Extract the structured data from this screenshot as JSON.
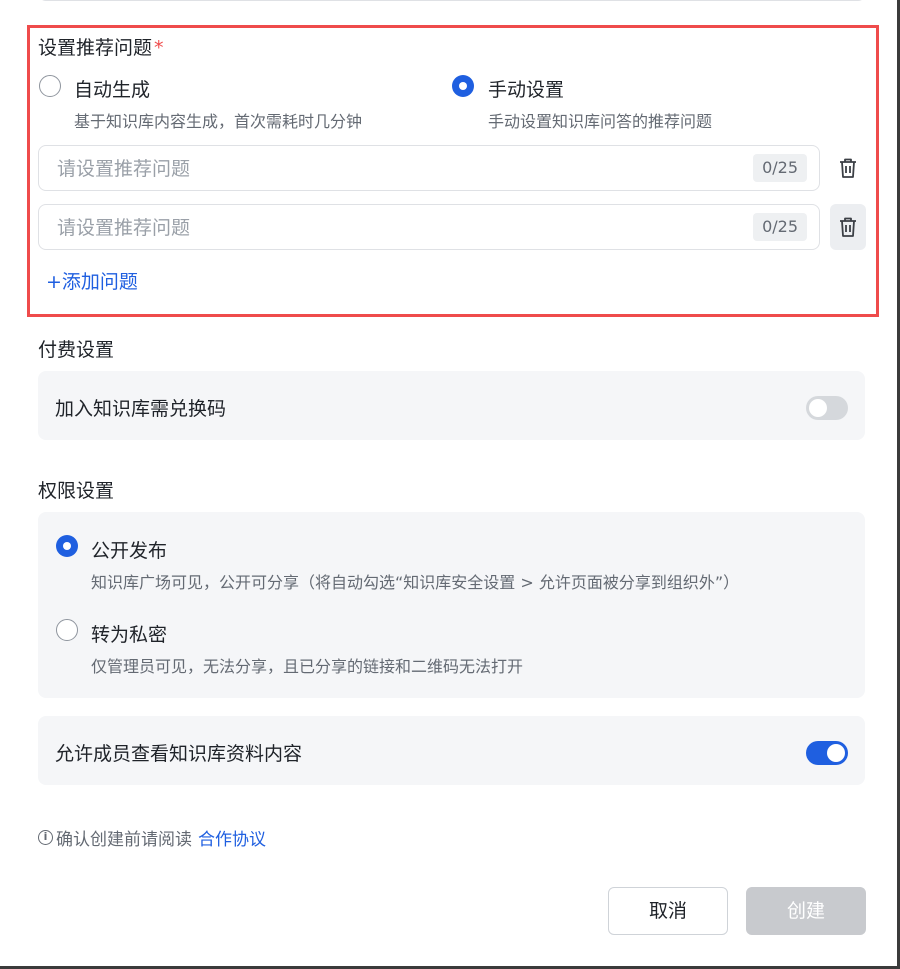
{
  "recommend": {
    "label": "设置推荐问题",
    "required_mark": "*",
    "options": [
      {
        "title": "自动生成",
        "desc": "基于知识库内容生成，首次需耗时几分钟",
        "checked": false
      },
      {
        "title": "手动设置",
        "desc": "手动设置知识库问答的推荐问题",
        "checked": true
      }
    ],
    "questions": [
      {
        "value": "",
        "placeholder": "请设置推荐问题",
        "counter": "0/25"
      },
      {
        "value": "",
        "placeholder": "请设置推荐问题",
        "counter": "0/25"
      }
    ],
    "add_label": "+添加问题"
  },
  "payment": {
    "label": "付费设置",
    "redeem_label": "加入知识库需兑换码",
    "redeem_enabled": false
  },
  "permission": {
    "label": "权限设置",
    "options": [
      {
        "title": "公开发布",
        "desc": "知识库广场可见，公开可分享（将自动勾选“知识库安全设置 > 允许页面被分享到组织外”）",
        "checked": true
      },
      {
        "title": "转为私密",
        "desc": "仅管理员可见，无法分享，且已分享的链接和二维码无法打开",
        "checked": false
      }
    ],
    "member_view_label": "允许成员查看知识库资料内容",
    "member_view_enabled": true
  },
  "notice": {
    "icon": "info-icon",
    "text": "确认创建前请阅读",
    "link": "合作协议"
  },
  "actions": {
    "cancel": "取消",
    "create": "创建"
  },
  "colors": {
    "accent": "#1f5fe0",
    "highlight_border": "#ef4b4b",
    "required": "#ef4b4b",
    "disabled_button": "#c8cace"
  }
}
